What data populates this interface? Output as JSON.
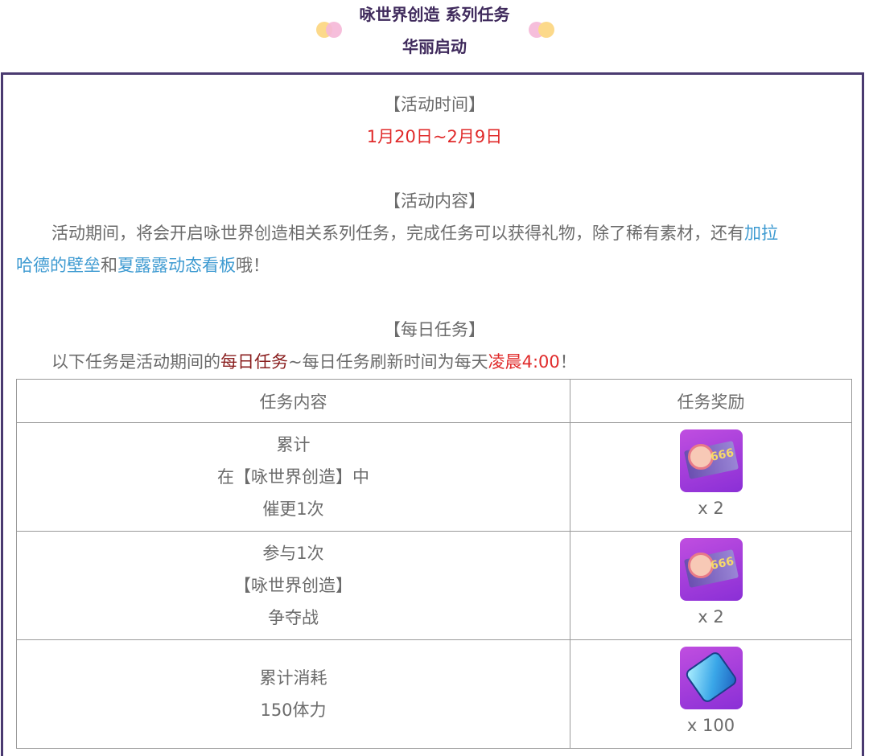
{
  "header": {
    "title_line1": "咏世界创造 系列任务",
    "title_line2": "华丽启动",
    "deco_icons": [
      "dots-left-icon",
      "dots-right-icon"
    ]
  },
  "activity_time": {
    "heading": "【活动时间】",
    "value": "1月20日~2月9日"
  },
  "activity_content": {
    "heading": "【活动内容】",
    "text_part1": "活动期间，将会开启咏世界创造相关系列任务，完成任务可以获得礼物，除了稀有素材，还有",
    "highlight1_line1": "加拉",
    "highlight1_line2": "哈德的壁垒",
    "connector": "和",
    "highlight2": "夏露露动态看板",
    "text_end": "哦！"
  },
  "daily_tasks": {
    "heading": "【每日任务】",
    "intro_part1": "以下任务是活动期间的",
    "intro_highlight": "每日任务",
    "intro_part2": "~每日任务刷新时间为每天",
    "intro_time": "凌晨4:00",
    "intro_end": "！",
    "table": {
      "headers": [
        "任务内容",
        "任务奖励"
      ],
      "rows": [
        {
          "content": [
            "累计",
            "在【咏世界创造】中",
            "催更1次"
          ],
          "reward_icon": "ticket-icon",
          "reward_qty": "x 2"
        },
        {
          "content": [
            "参与1次",
            "【咏世界创造】",
            "争夺战"
          ],
          "reward_icon": "ticket-icon",
          "reward_qty": "x 2"
        },
        {
          "content": [
            "累计消耗",
            "150体力"
          ],
          "reward_icon": "battery-icon",
          "reward_qty": "x 100"
        }
      ]
    }
  },
  "colors": {
    "frame": "#4a3a70",
    "title": "#3f2a5c",
    "red": "#e02a2a",
    "link_blue": "#3d9ad1"
  }
}
